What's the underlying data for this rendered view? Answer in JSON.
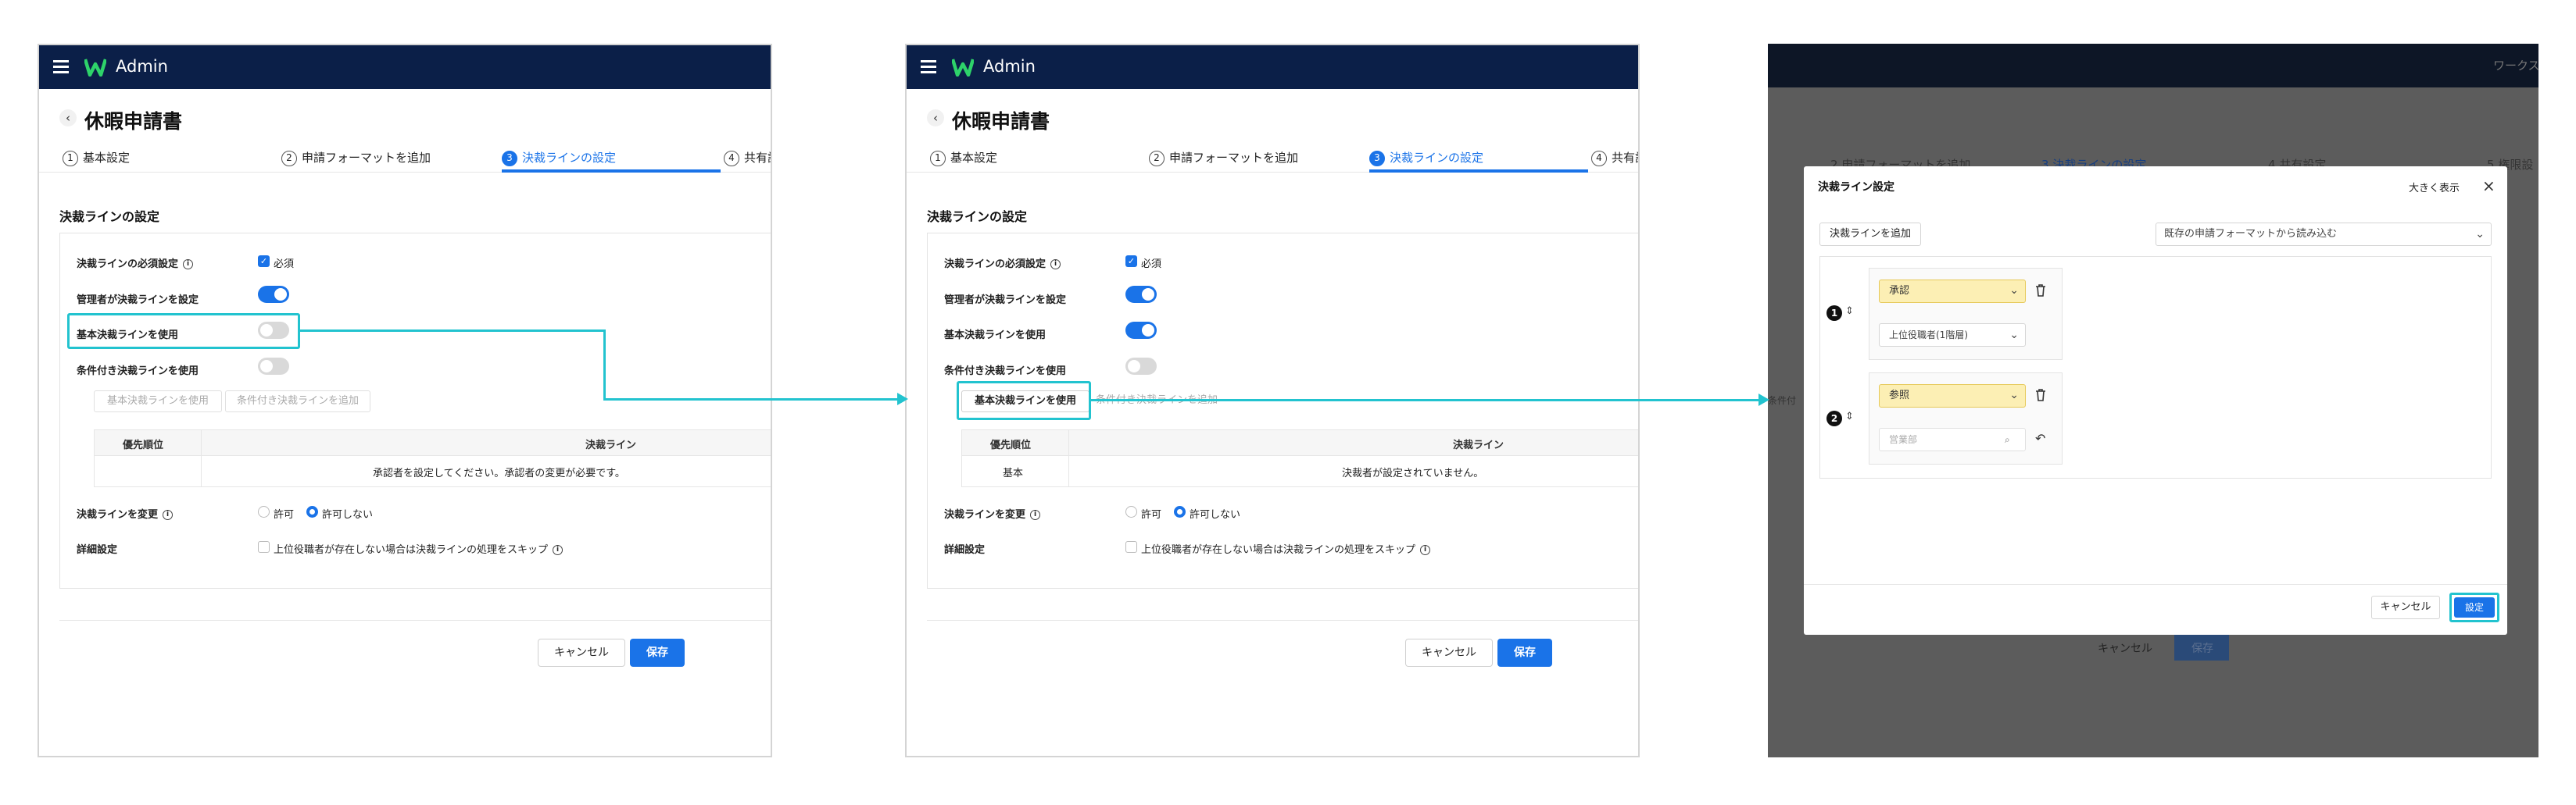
{
  "app": {
    "brand": "Admin"
  },
  "page": {
    "title": "休暇申請書",
    "back_icon": "chevron-left-icon"
  },
  "steps": [
    {
      "num": "1",
      "label": "基本設定"
    },
    {
      "num": "2",
      "label": "申請フォーマットを追加"
    },
    {
      "num": "3",
      "label": "決裁ラインの設定"
    },
    {
      "num": "4",
      "label": "共有設"
    }
  ],
  "section_title": "決裁ラインの設定",
  "settings": {
    "required_label": "決裁ラインの必須設定",
    "required_value": "必須",
    "admin_sets_label": "管理者が決裁ラインを設定",
    "use_basic_label": "基本決裁ラインを使用",
    "use_conditional_label": "条件付き決裁ラインを使用",
    "change_label": "決裁ラインを変更",
    "change_options": [
      "許可",
      "許可しない"
    ],
    "change_selected": "許可しない",
    "detail_label": "詳細設定",
    "detail_option": "上位役職者が存在しない場合は決裁ラインの処理をスキップ"
  },
  "panel1": {
    "toggles": {
      "admin_sets": true,
      "use_basic": false,
      "use_conditional": false
    },
    "buttons": [
      "基本決裁ラインを使用",
      "条件付き決裁ラインを追加"
    ],
    "table": {
      "headers": [
        "優先順位",
        "決裁ライン"
      ],
      "message": "承認者を設定してください。承認者の変更が必要です。"
    }
  },
  "panel2": {
    "toggles": {
      "admin_sets": true,
      "use_basic": true,
      "use_conditional": false
    },
    "buttons": [
      "基本決裁ラインを使用",
      "条件付き決裁ラインを追加"
    ],
    "table": {
      "headers": [
        "優先順位",
        "決裁ライン"
      ],
      "rows": [
        {
          "priority": "基本",
          "line": "決裁者が設定されていません。"
        }
      ]
    }
  },
  "footer": {
    "cancel": "キャンセル",
    "save": "保存"
  },
  "panel3": {
    "bg_title": "ワークス",
    "bg_steps": [
      {
        "num": "2",
        "label": "申請フォーマットを追加"
      },
      {
        "num": "3",
        "label": "決裁ラインの設定"
      },
      {
        "num": "4",
        "label": "共有設定"
      },
      {
        "num": "5",
        "label": "権限設"
      }
    ],
    "bg_side": "条件付",
    "bg_cancel": "キャンセル",
    "bg_save": "保存",
    "modal": {
      "title": "決裁ライン設定",
      "expand": "大きく表示",
      "add_button": "決裁ラインを追加",
      "load_select": "既存の申請フォーマットから読み込む",
      "steps": [
        {
          "badge": "1",
          "type": "承認",
          "sub": "上位役職者(1階層)"
        },
        {
          "badge": "2",
          "type": "参照",
          "search_placeholder": "営業部"
        }
      ],
      "cancel": "キャンセル",
      "confirm": "設定"
    }
  },
  "colors": {
    "accent": "#1a73e8",
    "highlight": "#22c3cf",
    "topbar": "#0b1f48",
    "overlay": "#5c5c5c",
    "pill": "#fcefb4"
  }
}
